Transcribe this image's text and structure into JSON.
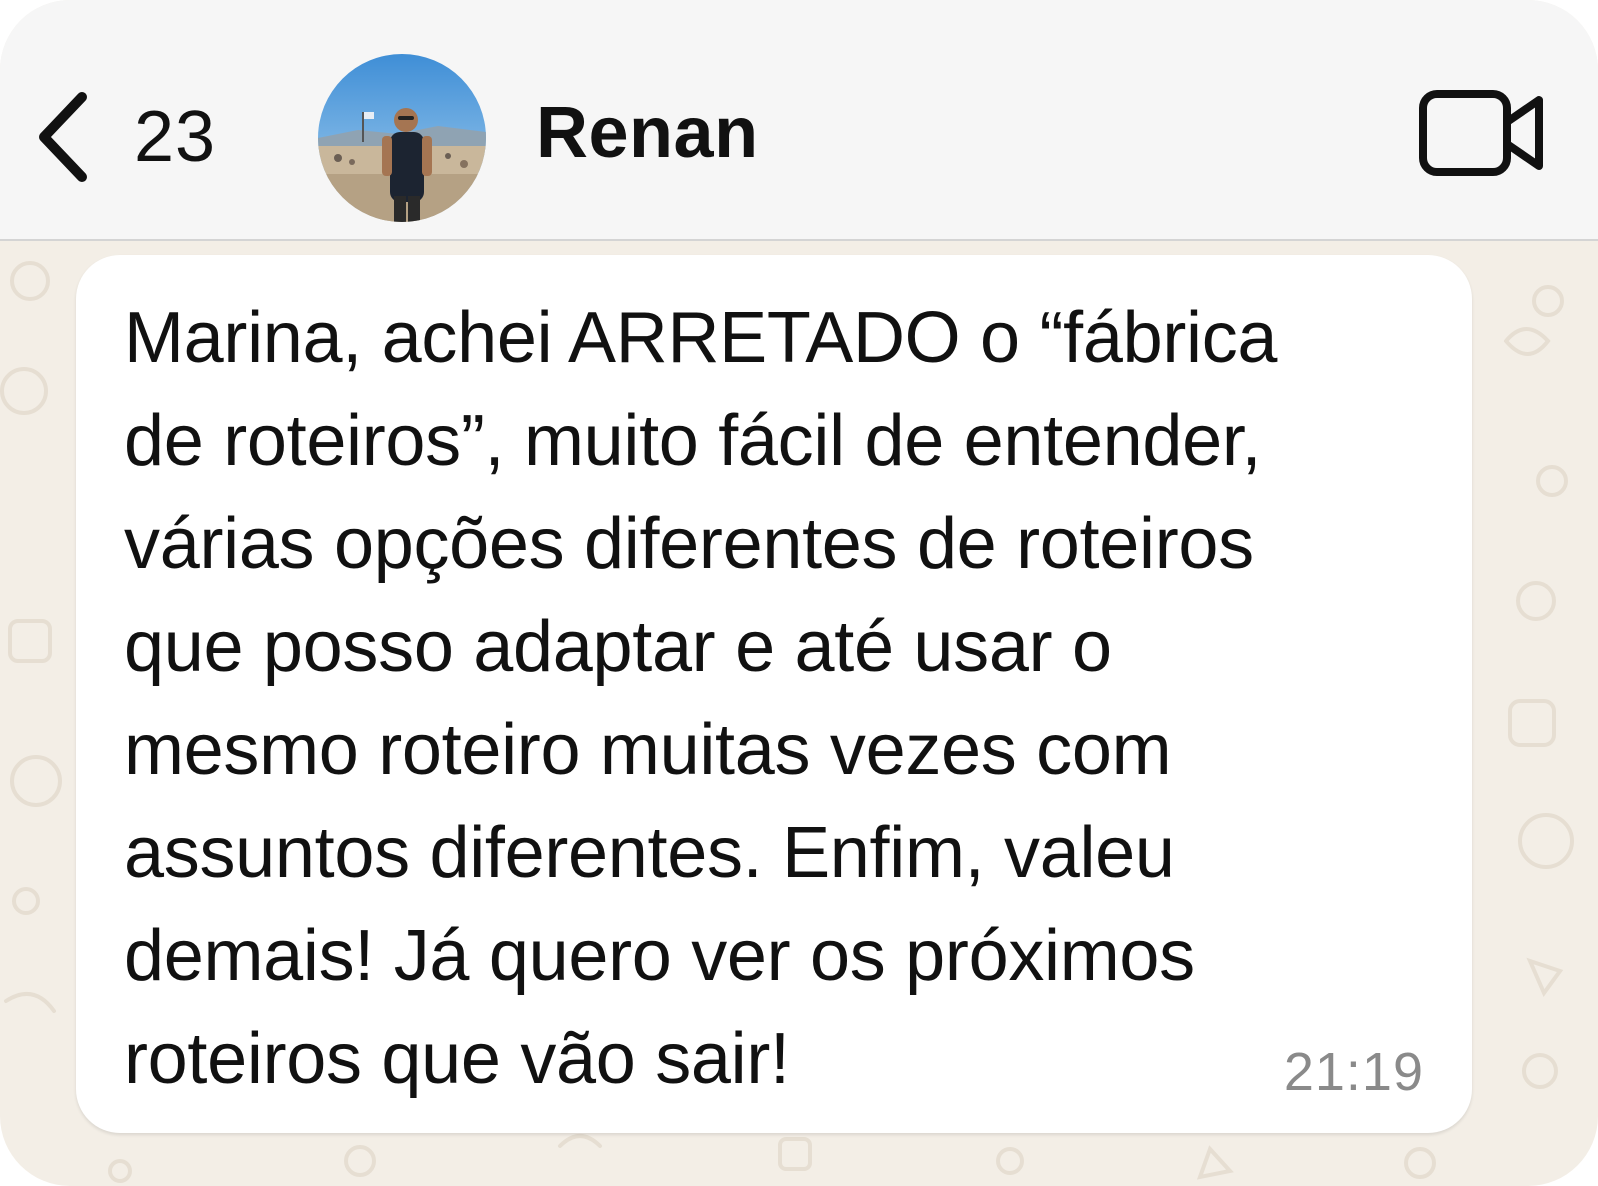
{
  "header": {
    "back_icon": "chevron-left-icon",
    "back_count": "23",
    "contact_name": "Renan",
    "video_icon": "video-camera-icon"
  },
  "message": {
    "text": "Marina, achei ARRETADO o “fábrica\nde roteiros”, muito fácil de entender,\nvárias opções diferentes de roteiros\nque posso adaptar e até usar o\nmesmo roteiro muitas vezes com\nassuntos diferentes. Enfim, valeu\ndemais! Já quero ver os próximos\nroteiros que vão sair!",
    "time": "21:19"
  },
  "colors": {
    "header_bg": "#f6f6f6",
    "chat_bg": "#f3eee6",
    "bubble_bg": "#ffffff",
    "timestamp": "#8a8a8a"
  }
}
